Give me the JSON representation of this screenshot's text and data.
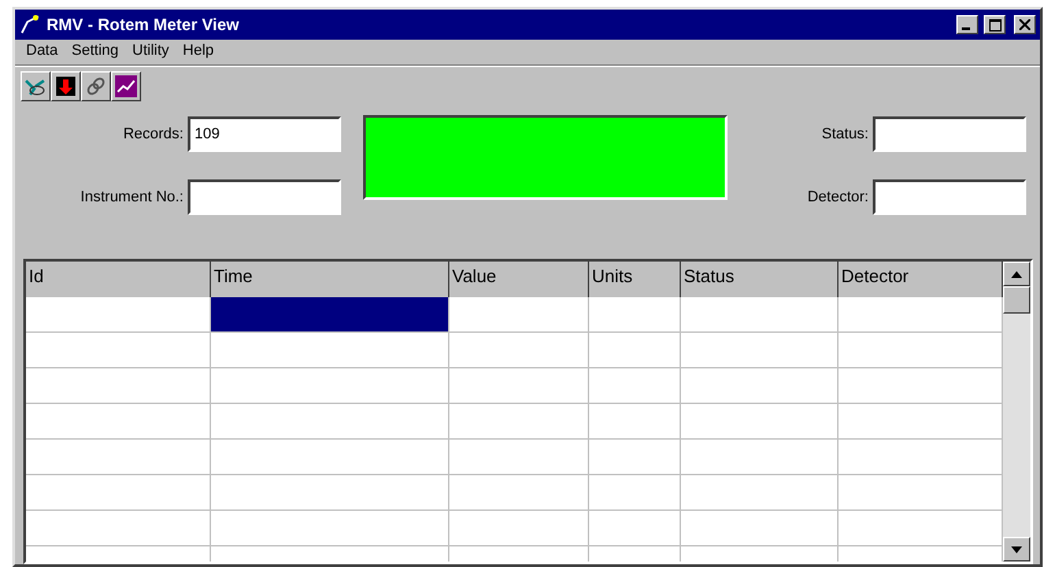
{
  "window": {
    "title": "RMV - Rotem Meter View"
  },
  "menu": [
    "Data",
    "Setting",
    "Utility",
    "Help"
  ],
  "fields": {
    "records": {
      "label": "Records:",
      "value": "109"
    },
    "instrument": {
      "label": "Instrument No.:"
    },
    "status": {
      "label": "Status:"
    },
    "detector": {
      "label": "Detector:"
    }
  },
  "table": {
    "columns": [
      "Id",
      "Time",
      "Value",
      "Units",
      "Status",
      "Detector"
    ],
    "rows": [
      {
        "cells": [
          {
            "selected": false
          },
          {
            "selected": true
          },
          {
            "selected": false
          },
          {
            "selected": false
          },
          {
            "selected": false
          },
          {
            "selected": false
          }
        ]
      },
      {
        "cells": [
          {
            "selected": false
          },
          {
            "selected": false
          },
          {
            "selected": false
          },
          {
            "selected": false
          },
          {
            "selected": false
          },
          {
            "selected": false
          }
        ]
      },
      {
        "cells": [
          {
            "selected": false
          },
          {
            "selected": false
          },
          {
            "selected": false
          },
          {
            "selected": false
          },
          {
            "selected": false
          },
          {
            "selected": false
          }
        ]
      },
      {
        "cells": [
          {
            "selected": false
          },
          {
            "selected": false
          },
          {
            "selected": false
          },
          {
            "selected": false
          },
          {
            "selected": false
          },
          {
            "selected": false
          }
        ]
      },
      {
        "cells": [
          {
            "selected": false
          },
          {
            "selected": false
          },
          {
            "selected": false
          },
          {
            "selected": false
          },
          {
            "selected": false
          },
          {
            "selected": false
          }
        ]
      },
      {
        "cells": [
          {
            "selected": false
          },
          {
            "selected": false
          },
          {
            "selected": false
          },
          {
            "selected": false
          },
          {
            "selected": false
          },
          {
            "selected": false
          }
        ]
      },
      {
        "cells": [
          {
            "selected": false
          },
          {
            "selected": false
          },
          {
            "selected": false
          },
          {
            "selected": false
          },
          {
            "selected": false
          },
          {
            "selected": false
          }
        ]
      },
      {
        "cells": [
          {
            "selected": false
          },
          {
            "selected": false
          },
          {
            "selected": false
          },
          {
            "selected": false
          },
          {
            "selected": false
          },
          {
            "selected": false
          }
        ]
      }
    ]
  }
}
